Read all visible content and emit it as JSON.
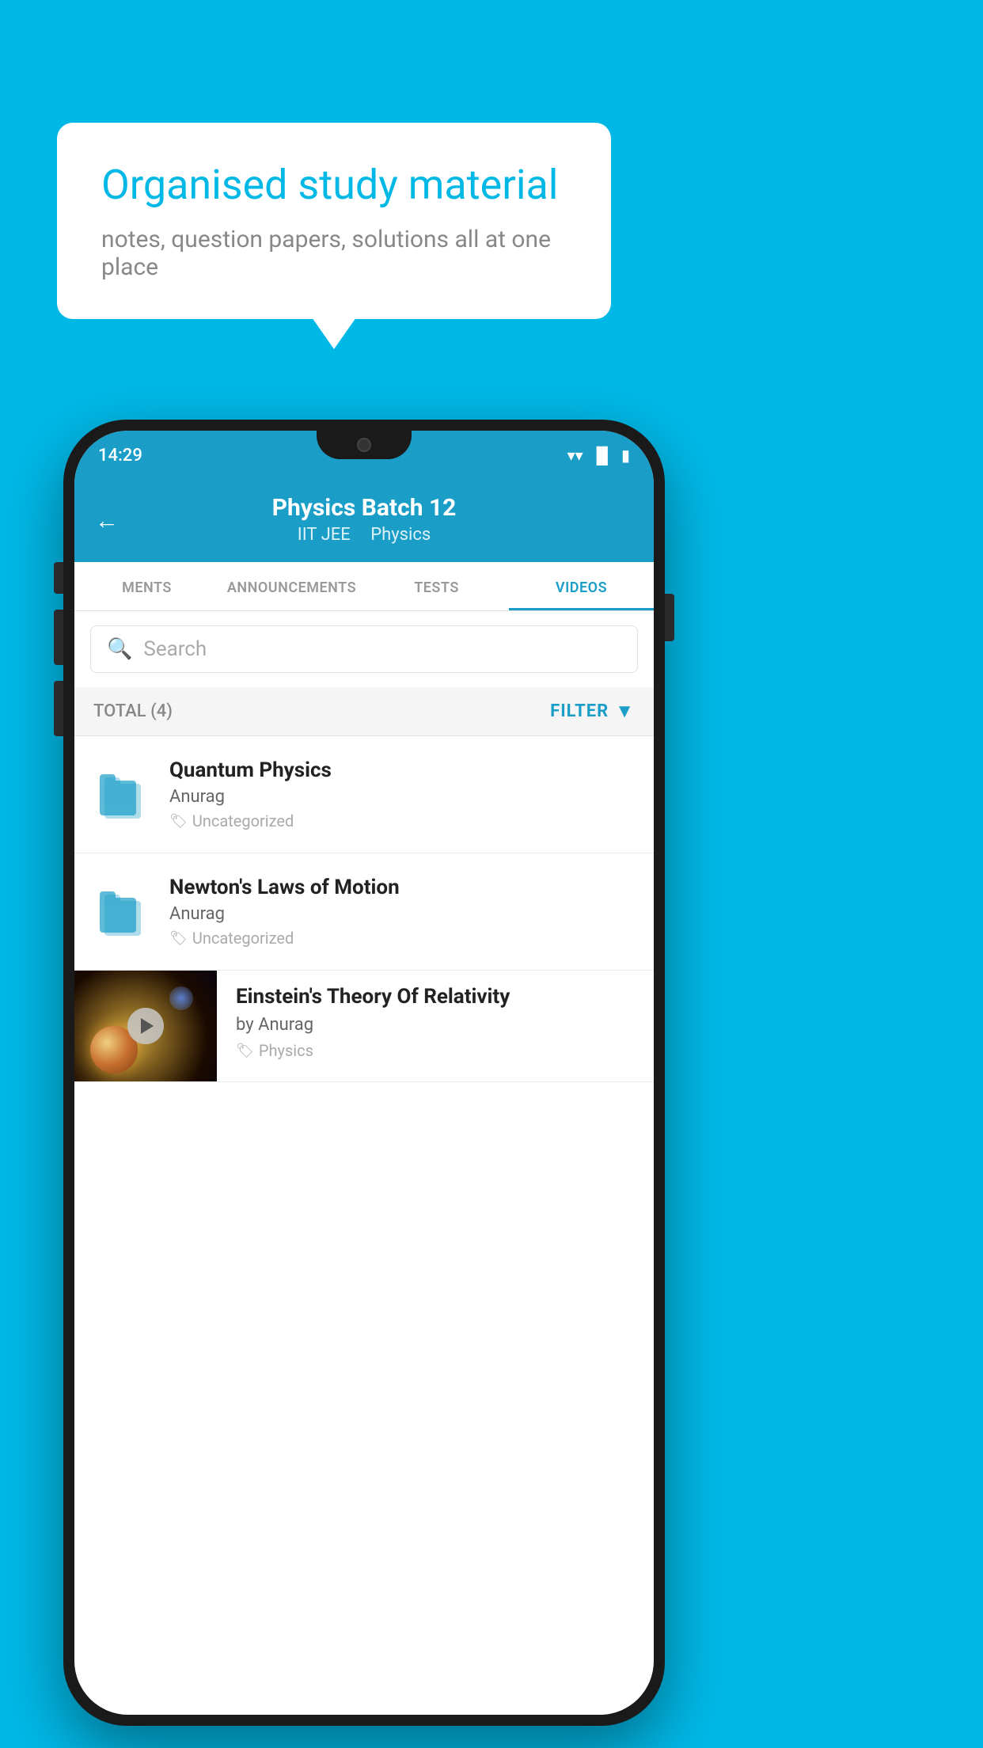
{
  "background_color": "#00b8e6",
  "speech_bubble": {
    "title": "Organised study material",
    "subtitle": "notes, question papers, solutions all at one place"
  },
  "status_bar": {
    "time": "14:29",
    "icons": [
      "wifi",
      "signal",
      "battery"
    ]
  },
  "app_header": {
    "back_arrow": "←",
    "title": "Physics Batch 12",
    "subtitle_1": "IIT JEE",
    "subtitle_2": "Physics"
  },
  "tabs": [
    {
      "label": "MENTS",
      "active": false
    },
    {
      "label": "ANNOUNCEMENTS",
      "active": false
    },
    {
      "label": "TESTS",
      "active": false
    },
    {
      "label": "VIDEOS",
      "active": true
    }
  ],
  "search": {
    "placeholder": "Search"
  },
  "filter_bar": {
    "total_label": "TOTAL (4)",
    "filter_label": "FILTER"
  },
  "videos": [
    {
      "title": "Quantum Physics",
      "author": "Anurag",
      "tag": "Uncategorized",
      "has_thumbnail": false
    },
    {
      "title": "Newton's Laws of Motion",
      "author": "Anurag",
      "tag": "Uncategorized",
      "has_thumbnail": false
    },
    {
      "title": "Einstein's Theory Of Relativity",
      "author": "by Anurag",
      "tag": "Physics",
      "has_thumbnail": true
    }
  ]
}
